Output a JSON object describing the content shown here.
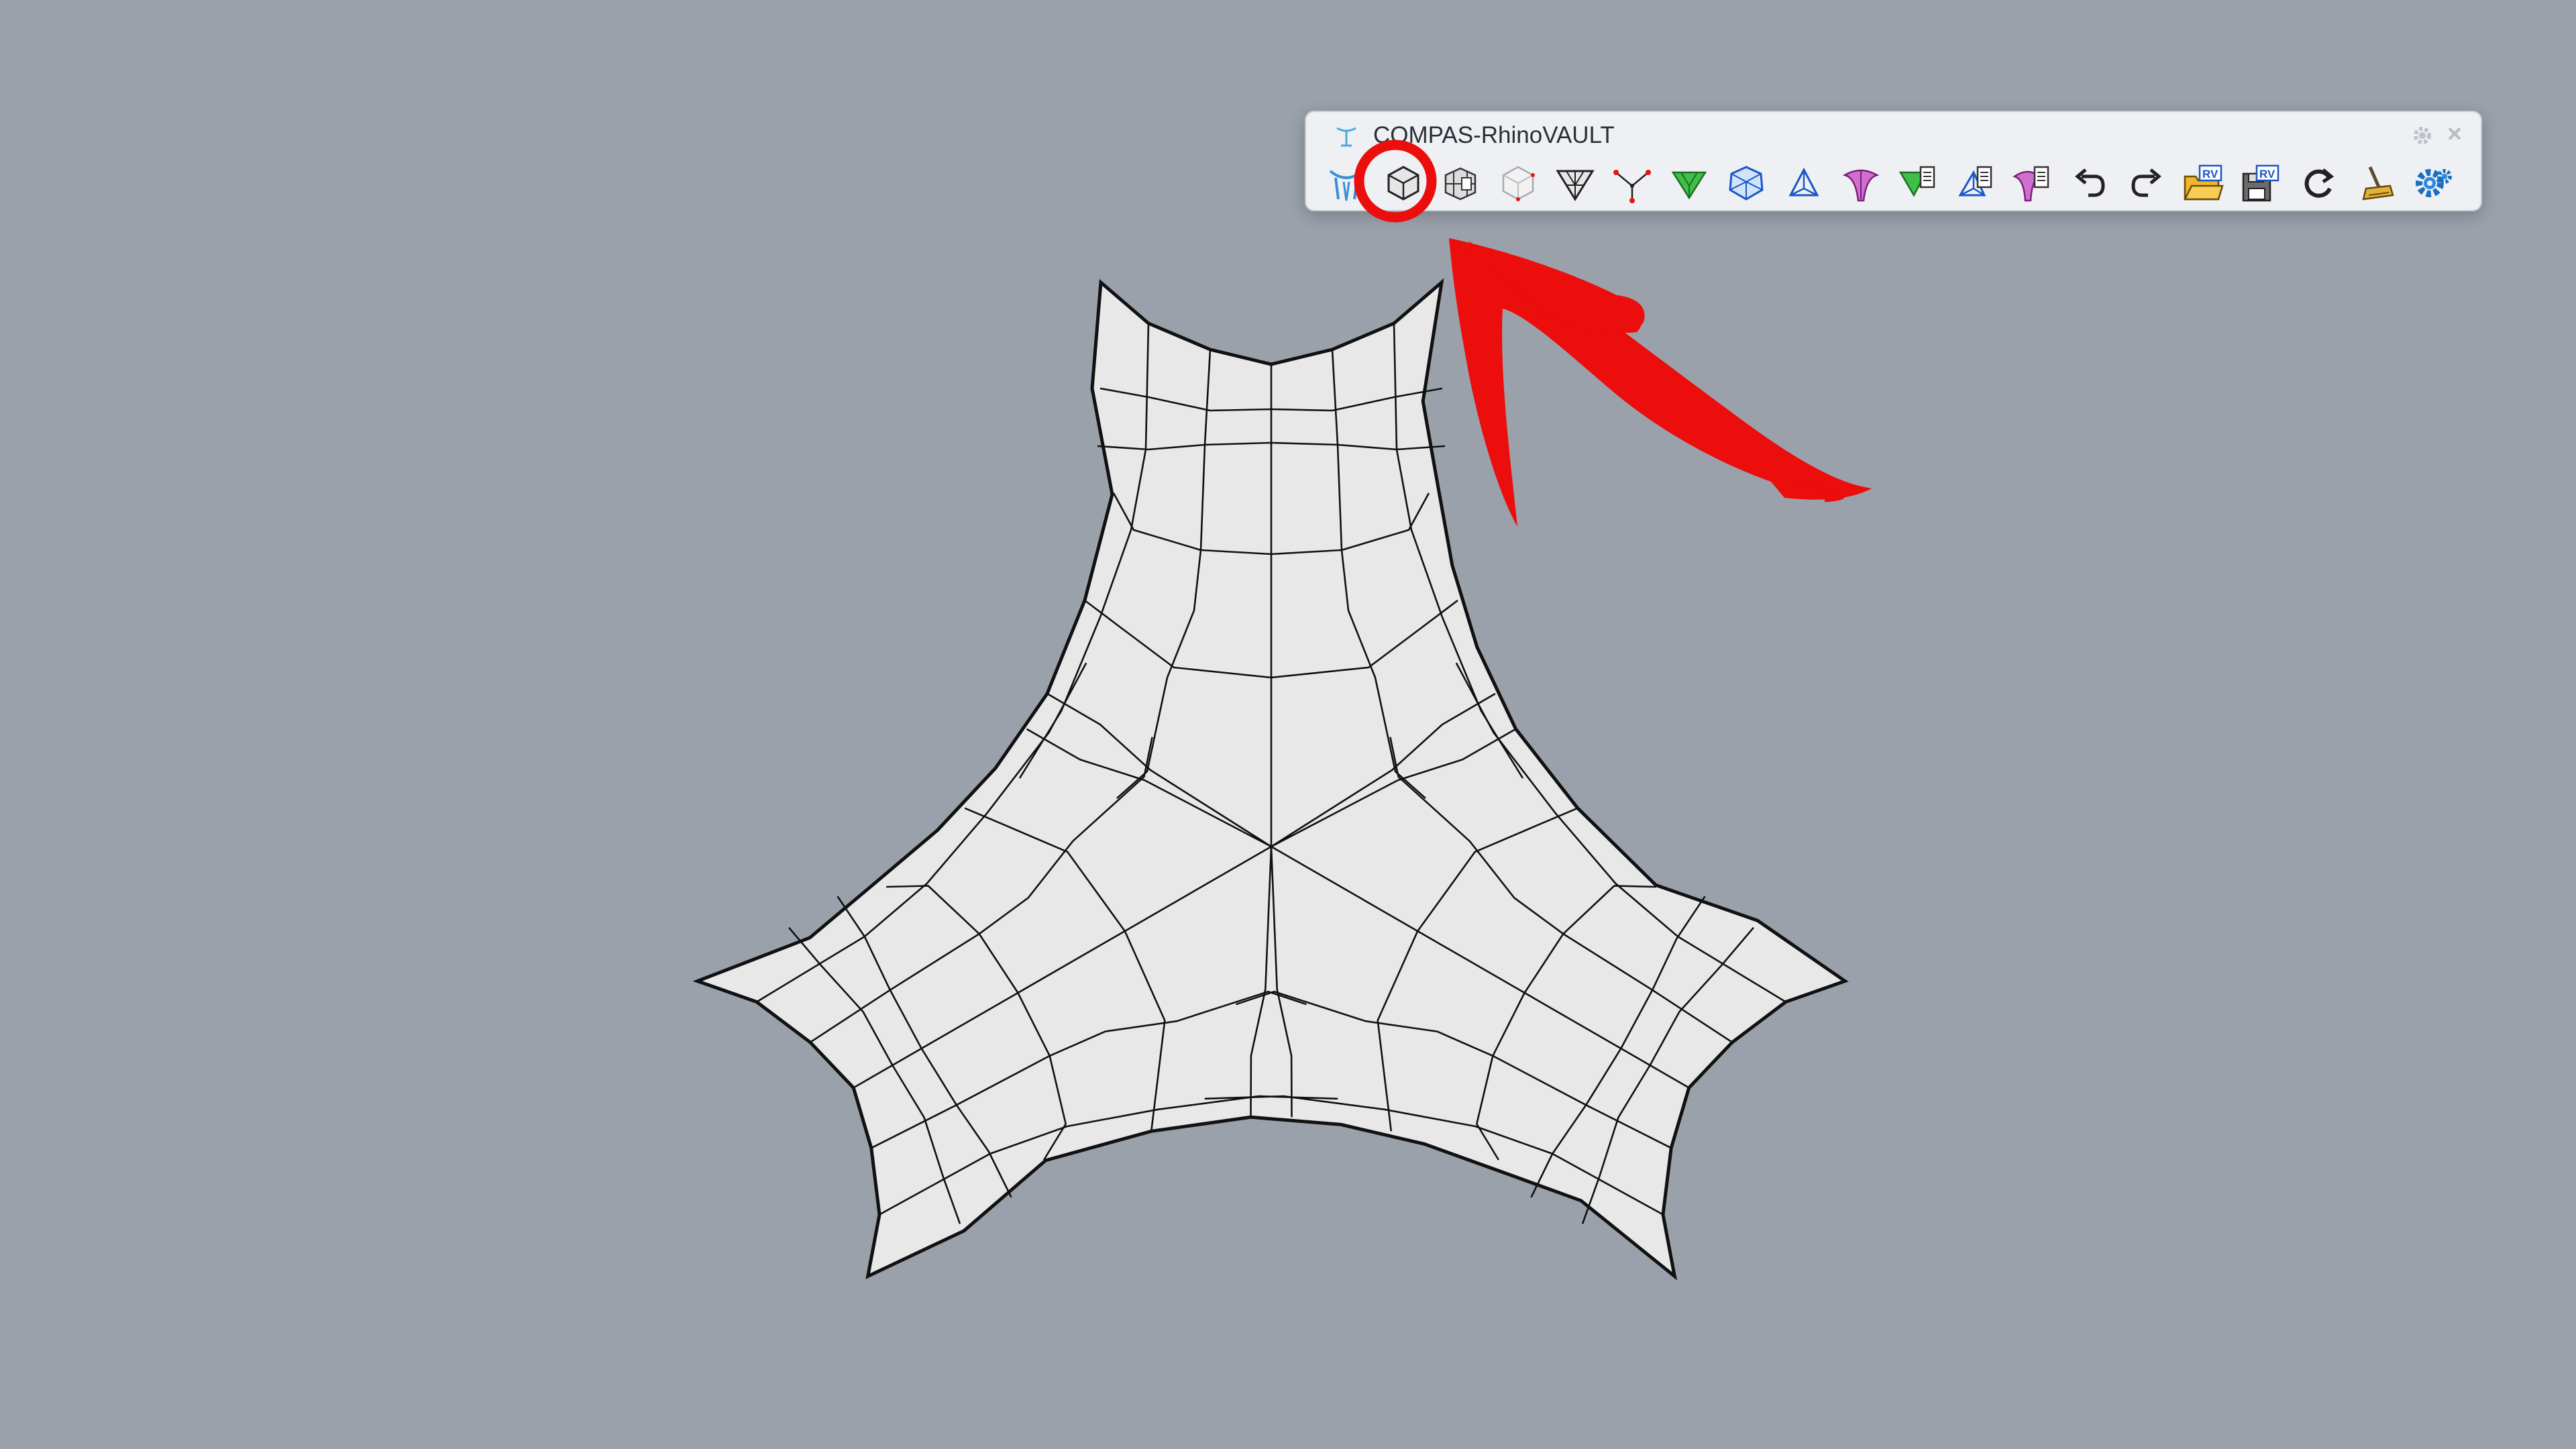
{
  "toolbar": {
    "title": "COMPAS-RhinoVAULT",
    "buttons": [
      {
        "name": "rhinovault-logo-button",
        "icon": "rhinovault-logo-icon"
      },
      {
        "name": "form-from-pattern-button",
        "icon": "pattern-box-icon",
        "highlighted": true
      },
      {
        "name": "pattern-from-lines-button",
        "icon": "pattern-lines-icon"
      },
      {
        "name": "pattern-from-surface-button",
        "icon": "pattern-surface-icon"
      },
      {
        "name": "boundaries-button",
        "icon": "triangle-mesh-icon"
      },
      {
        "name": "supports-button",
        "icon": "supports-icon"
      },
      {
        "name": "form-diagram-button",
        "icon": "green-form-icon"
      },
      {
        "name": "force-diagram-button",
        "icon": "blue-force-icon"
      },
      {
        "name": "horizontal-equilibrium-button",
        "icon": "blue-network-icon"
      },
      {
        "name": "vertical-equilibrium-button",
        "icon": "magenta-vault-icon"
      },
      {
        "name": "modify-form-button",
        "icon": "green-modify-icon"
      },
      {
        "name": "modify-force-button",
        "icon": "blue-modify-icon"
      },
      {
        "name": "modify-thrust-button",
        "icon": "magenta-modify-icon"
      },
      {
        "name": "undo-button",
        "icon": "undo-icon"
      },
      {
        "name": "redo-button",
        "icon": "redo-icon"
      },
      {
        "name": "open-session-button",
        "icon": "open-folder-rv-icon"
      },
      {
        "name": "save-session-button",
        "icon": "save-rv-icon"
      },
      {
        "name": "reload-button",
        "icon": "refresh-icon"
      },
      {
        "name": "clear-button",
        "icon": "broom-icon"
      },
      {
        "name": "settings-button",
        "icon": "gear-blue-icon"
      }
    ]
  },
  "annotation": {
    "arrow_color": "#ec0d0d",
    "circle_color": "#ec0d0d"
  },
  "mesh": {
    "fill": "#e8e8e8",
    "edge_color": "#111111"
  }
}
